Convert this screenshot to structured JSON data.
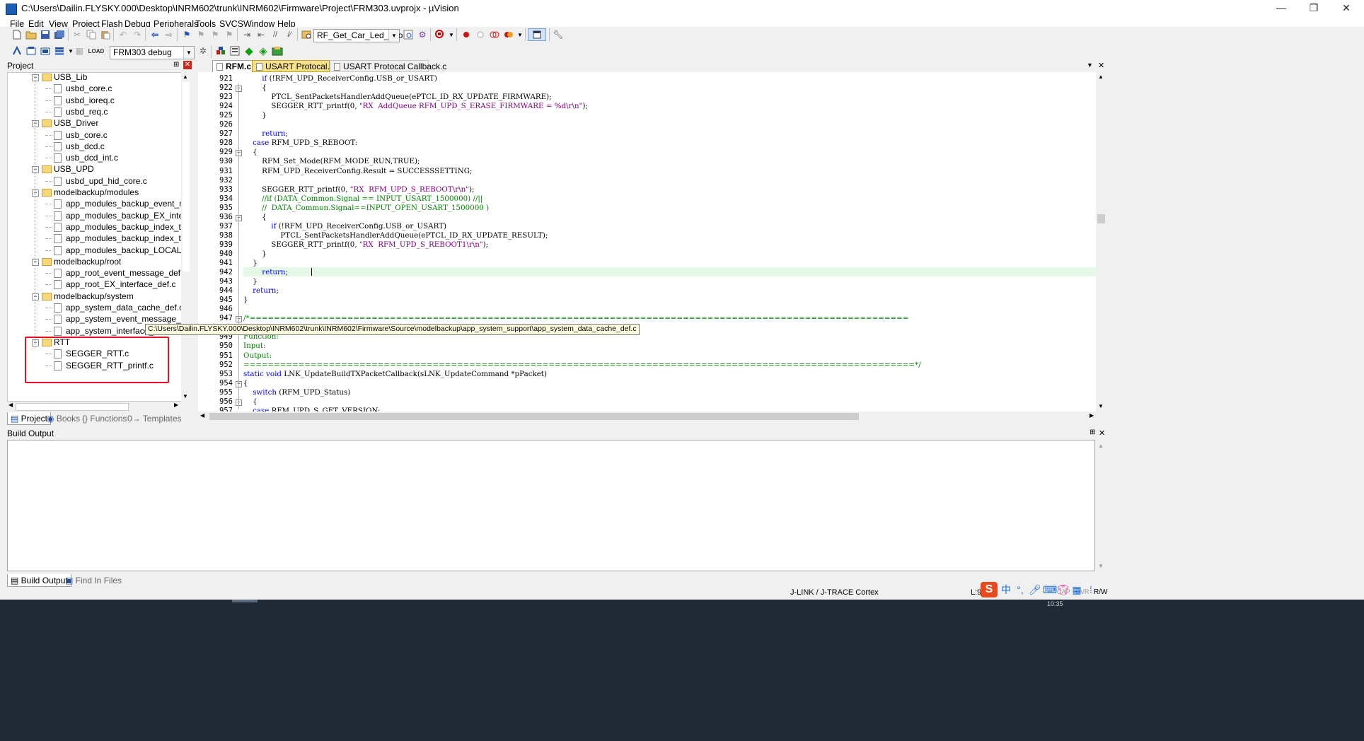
{
  "window": {
    "title": "C:\\Users\\Dailin.FLYSKY.000\\Desktop\\INRM602\\trunk\\INRM602\\Firmware\\Project\\FRM303.uvprojx - µVision",
    "minimize": "—",
    "maximize": "❐",
    "close": "✕"
  },
  "menu": [
    "File",
    "Edit",
    "View",
    "Project",
    "Flash",
    "Debug",
    "Peripherals",
    "Tools",
    "SVCS",
    "Window",
    "Help"
  ],
  "toolbar1": {
    "function_combo": "RF_Get_Car_Led_Info"
  },
  "toolbar2": {
    "target_combo": "FRM303 debug"
  },
  "project_panel": {
    "title": "Project",
    "pin": "⊞",
    "close": "✕",
    "tree": [
      {
        "label": "USB_Lib",
        "type": "folder"
      },
      {
        "label": "usbd_core.c",
        "type": "file"
      },
      {
        "label": "usbd_ioreq.c",
        "type": "file"
      },
      {
        "label": "usbd_req.c",
        "type": "file"
      },
      {
        "label": "USB_Driver",
        "type": "folder"
      },
      {
        "label": "usb_core.c",
        "type": "file"
      },
      {
        "label": "usb_dcd.c",
        "type": "file"
      },
      {
        "label": "usb_dcd_int.c",
        "type": "file"
      },
      {
        "label": "USB_UPD",
        "type": "folder"
      },
      {
        "label": "usbd_upd_hid_core.c",
        "type": "file"
      },
      {
        "label": "modelbackup/modules",
        "type": "folder"
      },
      {
        "label": "app_modules_backup_event_message_",
        "type": "file"
      },
      {
        "label": "app_modules_backup_EX_interface_de",
        "type": "file"
      },
      {
        "label": "app_modules_backup_index_table.c",
        "type": "file"
      },
      {
        "label": "app_modules_backup_index_table_for_",
        "type": "file"
      },
      {
        "label": "app_modules_backup_LOCAL_func_de",
        "type": "file"
      },
      {
        "label": "modelbackup/root",
        "type": "folder"
      },
      {
        "label": "app_root_event_message_def.c",
        "type": "file"
      },
      {
        "label": "app_root_EX_interface_def.c",
        "type": "file"
      },
      {
        "label": "modelbackup/system",
        "type": "folder"
      },
      {
        "label": "app_system_data_cache_def.c",
        "type": "file"
      },
      {
        "label": "app_system_event_message_def.c",
        "type": "file"
      },
      {
        "label": "app_system_interface_def.c",
        "type": "file"
      },
      {
        "label": "RTT",
        "type": "folder"
      },
      {
        "label": "SEGGER_RTT.c",
        "type": "file"
      },
      {
        "label": "SEGGER_RTT_printf.c",
        "type": "file"
      }
    ],
    "bottom_tabs": [
      "Project",
      "Books",
      "Functions",
      "Templates"
    ]
  },
  "tooltip": "C:\\Users\\Dailin.FLYSKY.000\\Desktop\\INRM602\\trunk\\INRM602\\Firmware\\Source\\modelbackup\\app_system_support\\app_system_data_cache_def.c",
  "editor": {
    "tabs": [
      "RFM.c",
      "USART Protocal.c",
      "USART Protocal Callback.c"
    ],
    "tab_menu": "▼",
    "tab_close": "✕",
    "lines": [
      {
        "n": "921",
        "t": "        if (!RFM_UPD_ReceiverConfig.USB_or_USART)"
      },
      {
        "n": "922",
        "t": "        {"
      },
      {
        "n": "923",
        "t": "            PTCL_SentPacketsHandlerAddQueue(ePTCL_ID_RX_UPDATE_FIRMWARE);"
      },
      {
        "n": "924",
        "t": "            SEGGER_RTT_printf(0, \"RX  AddQueue RFM_UPD_S_ERASE_FIRMWARE = %d\\r\\n\");"
      },
      {
        "n": "925",
        "t": "        }"
      },
      {
        "n": "926",
        "t": ""
      },
      {
        "n": "927",
        "t": "        return;"
      },
      {
        "n": "928",
        "t": "    case RFM_UPD_S_REBOOT:"
      },
      {
        "n": "929",
        "t": "    {"
      },
      {
        "n": "930",
        "t": "        RFM_Set_Mode(RFM_MODE_RUN,TRUE);"
      },
      {
        "n": "931",
        "t": "        RFM_UPD_ReceiverConfig.Result = SUCCESSSETTING;"
      },
      {
        "n": "932",
        "t": ""
      },
      {
        "n": "933",
        "t": "        SEGGER_RTT_printf(0, \"RX  RFM_UPD_S_REBOOT\\r\\n\");"
      },
      {
        "n": "934",
        "t": "        //if (DATA_Common.Signal == INPUT_USART_1500000) //||"
      },
      {
        "n": "935",
        "t": "        //  DATA_Common.Signal==INPUT_OPEN_USART_1500000 )"
      },
      {
        "n": "936",
        "t": "        {"
      },
      {
        "n": "937",
        "t": "            if (!RFM_UPD_ReceiverConfig.USB_or_USART)"
      },
      {
        "n": "938",
        "t": "                PTCL_SentPacketsHandlerAddQueue(ePTCL_ID_RX_UPDATE_RESULT);"
      },
      {
        "n": "939",
        "t": "            SEGGER_RTT_printf(0, \"RX  RFM_UPD_S_REBOOT1\\r\\n\");"
      },
      {
        "n": "940",
        "t": "        }"
      },
      {
        "n": "941",
        "t": "    }"
      },
      {
        "n": "942",
        "t": "        return;"
      },
      {
        "n": "943",
        "t": "    }"
      },
      {
        "n": "944",
        "t": "    return;"
      },
      {
        "n": "945",
        "t": "}"
      },
      {
        "n": "946",
        "t": ""
      },
      {
        "n": "947",
        "t": "/*============================================================================================================"
      },
      {
        "n": "948",
        "t": ""
      },
      {
        "n": "949",
        "t": "Function:"
      },
      {
        "n": "950",
        "t": "Input:"
      },
      {
        "n": "951",
        "t": "Output:"
      },
      {
        "n": "952",
        "t": "==============================================================================================================*/"
      },
      {
        "n": "953",
        "t": "static void LNK_UpdateBuildTXPacketCallback(sLNK_UpdateCommand *pPacket)"
      },
      {
        "n": "954",
        "t": "{"
      },
      {
        "n": "955",
        "t": "    switch (RFM_UPD_Status)"
      },
      {
        "n": "956",
        "t": "    {"
      },
      {
        "n": "957",
        "t": "    case RFM_UPD_S_GET_VERSION:"
      }
    ]
  },
  "build_output": {
    "title": "Build Output",
    "pin": "⊞",
    "close": "✕",
    "tabs": [
      "Build Output",
      "Find In Files"
    ]
  },
  "status": {
    "debugger": "J-LINK / J-TRACE Cortex",
    "cursor": "L:9",
    "caps": "CAP",
    "ovr": "OVR",
    "rw": "R/W"
  },
  "tray": {
    "ime_logo": "S",
    "ime_lang": "中",
    "clock": "10:35"
  }
}
